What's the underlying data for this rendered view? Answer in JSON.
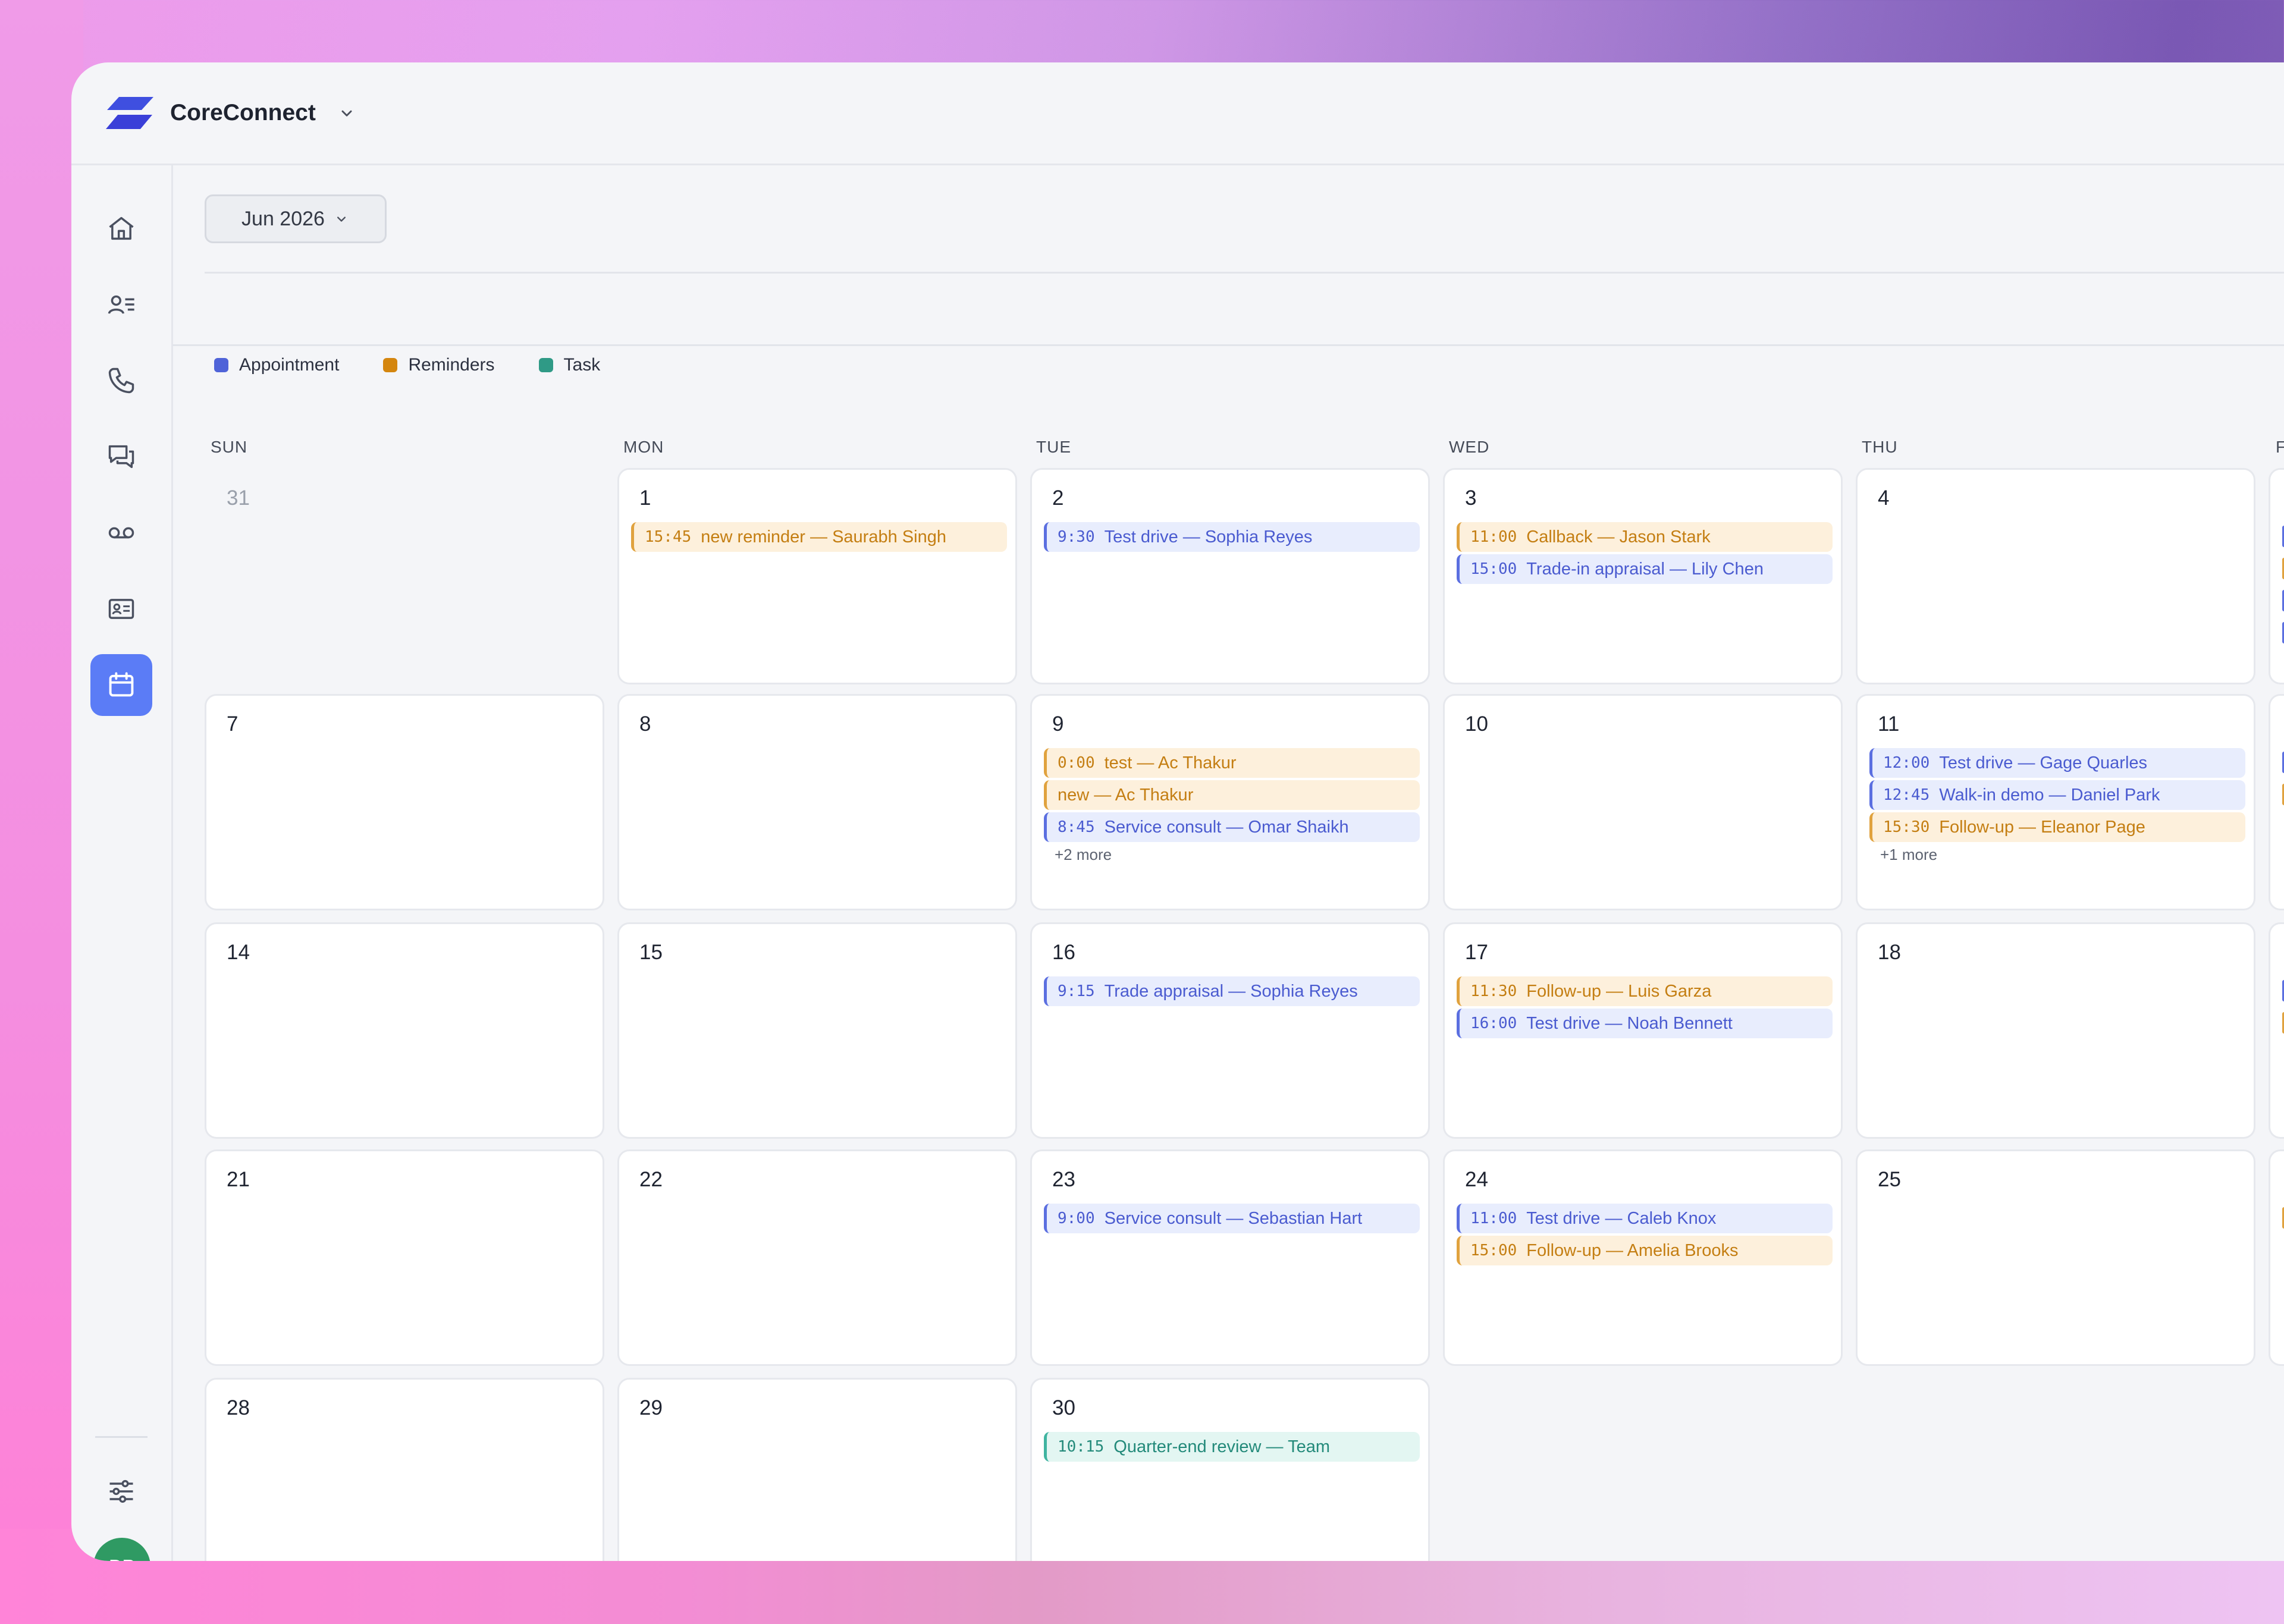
{
  "app": {
    "name": "CoreConnect",
    "month_label": "Jun 2026",
    "user_initials": "DP"
  },
  "sidebar": {
    "icons": [
      "home-icon",
      "contacts-icon",
      "phone-icon",
      "chat-icon",
      "voicemail-icon",
      "id-card-icon",
      "calendar-icon",
      "filters-icon"
    ],
    "active": "calendar-icon"
  },
  "legend": [
    {
      "label": "Appointment",
      "color": "#4f63d8"
    },
    {
      "label": "Reminders",
      "color": "#d4860f"
    },
    {
      "label": "Task",
      "color": "#2f9a86"
    }
  ],
  "days_of_week": [
    "SUN",
    "MON",
    "TUE",
    "WED",
    "THU",
    "F"
  ],
  "weeks": [
    [
      {
        "day": "31",
        "other": true,
        "events": []
      },
      {
        "day": "1",
        "events": [
          {
            "type": "rem",
            "time": "15:45",
            "text": "new reminder — Saurabh Singh"
          }
        ]
      },
      {
        "day": "2",
        "events": [
          {
            "type": "appt",
            "time": "9:30",
            "text": "Test drive — Sophia Reyes"
          }
        ]
      },
      {
        "day": "3",
        "events": [
          {
            "type": "rem",
            "time": "11:00",
            "text": "Callback — Jason Stark"
          },
          {
            "type": "appt",
            "time": "15:00",
            "text": "Trade-in appraisal — Lily Chen"
          }
        ]
      },
      {
        "day": "4",
        "events": []
      }
    ],
    [
      {
        "day": "7",
        "events": []
      },
      {
        "day": "8",
        "events": []
      },
      {
        "day": "9",
        "events": [
          {
            "type": "rem",
            "time": "0:00",
            "text": "test — Ac Thakur"
          },
          {
            "type": "rem",
            "time": "",
            "text": "new — Ac Thakur"
          },
          {
            "type": "appt",
            "time": "8:45",
            "text": "Service consult — Omar Shaikh"
          }
        ],
        "more": "+2 more"
      },
      {
        "day": "10",
        "events": []
      },
      {
        "day": "11",
        "events": [
          {
            "type": "appt",
            "time": "12:00",
            "text": "Test drive — Gage Quarles"
          },
          {
            "type": "appt",
            "time": "12:45",
            "text": "Walk-in demo — Daniel Park"
          },
          {
            "type": "rem",
            "time": "15:30",
            "text": "Follow-up — Eleanor Page"
          }
        ],
        "more": "+1 more"
      }
    ],
    [
      {
        "day": "14",
        "events": []
      },
      {
        "day": "15",
        "events": []
      },
      {
        "day": "16",
        "events": [
          {
            "type": "appt",
            "time": "9:15",
            "text": "Trade appraisal — Sophia Reyes"
          }
        ]
      },
      {
        "day": "17",
        "events": [
          {
            "type": "rem",
            "time": "11:30",
            "text": "Follow-up — Luis Garza"
          },
          {
            "type": "appt",
            "time": "16:00",
            "text": "Test drive — Noah Bennett"
          }
        ]
      },
      {
        "day": "18",
        "events": []
      }
    ],
    [
      {
        "day": "21",
        "events": []
      },
      {
        "day": "22",
        "events": []
      },
      {
        "day": "23",
        "events": [
          {
            "type": "appt",
            "time": "9:00",
            "text": "Service consult — Sebastian Hart"
          }
        ]
      },
      {
        "day": "24",
        "events": [
          {
            "type": "appt",
            "time": "11:00",
            "text": "Test drive — Caleb Knox"
          },
          {
            "type": "rem",
            "time": "15:00",
            "text": "Follow-up — Amelia Brooks"
          }
        ]
      },
      {
        "day": "25",
        "events": []
      }
    ],
    [
      {
        "day": "28",
        "events": []
      },
      {
        "day": "29",
        "events": []
      },
      {
        "day": "30",
        "events": [
          {
            "type": "task",
            "time": "10:15",
            "text": "Quarter-end review — Team"
          }
        ]
      }
    ]
  ]
}
